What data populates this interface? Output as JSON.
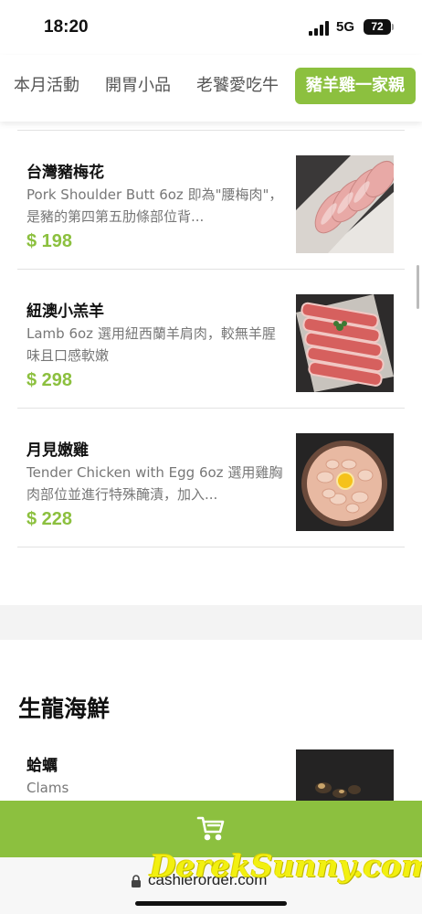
{
  "status_bar": {
    "time": "18:20",
    "network": "5G",
    "battery": "72"
  },
  "tabs": [
    {
      "label": "本月活動"
    },
    {
      "label": "開胃小品"
    },
    {
      "label": "老饕愛吃牛"
    },
    {
      "label": "豬羊雞一家親",
      "active": true
    }
  ],
  "menu": {
    "items": [
      {
        "name": "台灣豬梅花",
        "desc": "Pork Shoulder Butt 6oz 即為\"腰梅肉\"，是豬的第四第五肋條部位背...",
        "price": "$ 198",
        "image": "pork-slices"
      },
      {
        "name": "紐澳小羔羊",
        "desc": "Lamb 6oz 選用紐西蘭羊肩肉，較無羊腥味且口感軟嫩",
        "price": "$ 298",
        "image": "lamb-slices"
      },
      {
        "name": "月見嫩雞",
        "desc": "Tender Chicken with Egg 6oz 選用雞胸肉部位並進行特殊醃漬，加入...",
        "price": "$ 228",
        "image": "chicken-egg-bowl"
      }
    ],
    "section_title": "生龍海鮮",
    "section_items": [
      {
        "name": "蛤蠣",
        "desc": "Clams",
        "image": "clams-dark"
      }
    ]
  },
  "cart": {
    "icon": "cart-icon"
  },
  "browser": {
    "url": "cashierorder.com"
  },
  "watermark": "DerekSunny.com",
  "colors": {
    "accent": "#8cc03f",
    "price": "#8cc03f"
  }
}
